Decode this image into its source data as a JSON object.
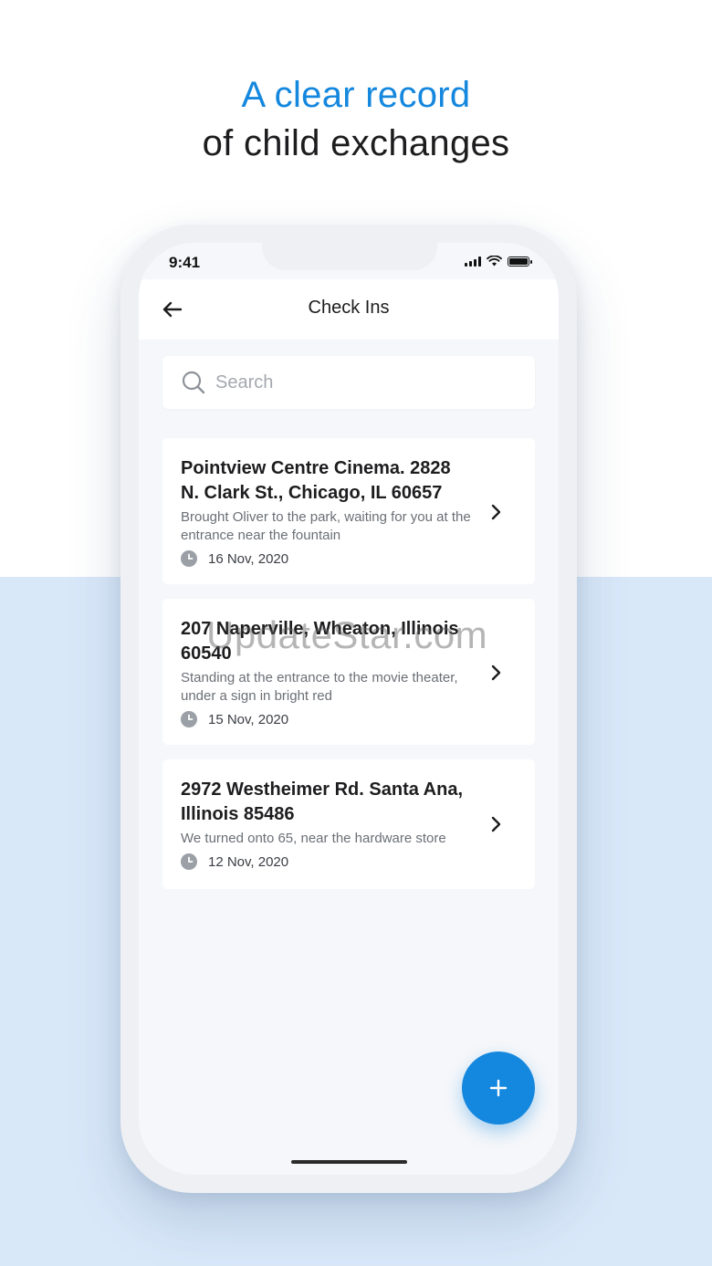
{
  "headline": {
    "line1": "A clear record",
    "line2": "of child exchanges"
  },
  "status_bar": {
    "time": "9:41"
  },
  "header": {
    "title": "Check Ins",
    "back_icon": "arrow-left-icon"
  },
  "search": {
    "placeholder": "Search",
    "value": ""
  },
  "checkins": [
    {
      "title": "Pointview Centre Cinema. 2828 N. Clark St., Chicago, IL 60657",
      "description": "Brought Oliver to the park, waiting for you at the entrance near the fountain",
      "date": "16 Nov, 2020"
    },
    {
      "title": "207 Naperville, Wheaton, Illinois 60540",
      "description": "Standing at the entrance to the movie theater, under a sign in bright red",
      "date": "15 Nov, 2020"
    },
    {
      "title": "2972 Westheimer Rd. Santa Ana, Illinois 85486",
      "description": "We turned onto 65, near the hardware store",
      "date": "12 Nov, 2020"
    }
  ],
  "watermark": "UpdateStar.com",
  "colors": {
    "accent": "#1487de",
    "lower_background": "#d9e8f9",
    "text_dark": "#1d1d1f",
    "text_muted": "#6b6f75",
    "clock_icon": "#9aa0a6"
  }
}
